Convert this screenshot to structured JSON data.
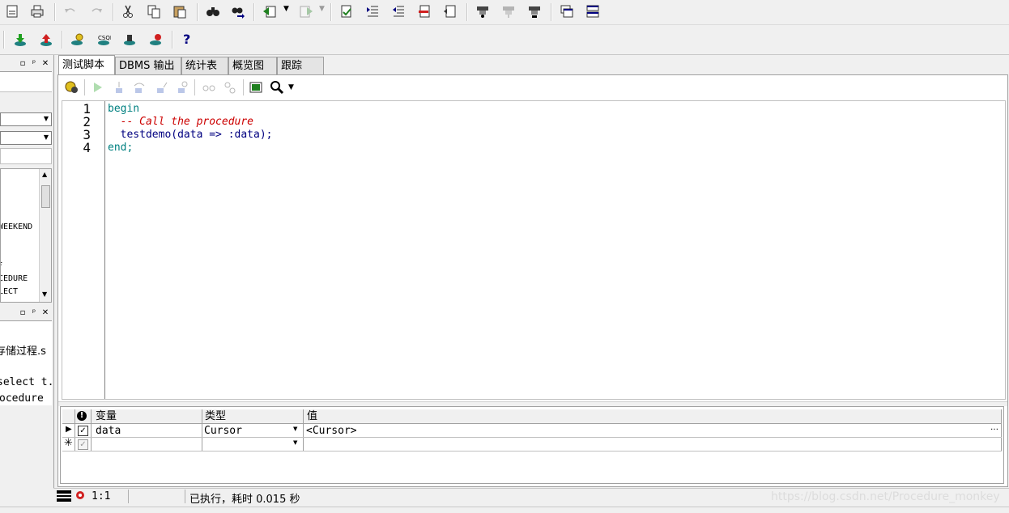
{
  "toolbar_row1": {
    "icons": [
      "new-doc-icon",
      "print-icon",
      "undo-icon",
      "redo-icon",
      "cut-icon",
      "copy-icon",
      "paste-icon",
      "find-icon",
      "replace-icon",
      "back-icon",
      "forward-icon",
      "indent-icon",
      "increase-indent-icon",
      "decrease-indent-icon",
      "comment-icon",
      "uncomment-icon",
      "exec-icon",
      "debug-icon",
      "step-icon",
      "window-list-icon",
      "tile-icon"
    ]
  },
  "toolbar_row2": {
    "help_label": "?"
  },
  "left_panel": {
    "tree_items": [
      "WEEKEND",
      "F",
      "CEDURE",
      "LECT"
    ],
    "files": [
      "存储过程.s",
      "select t.*",
      "ocedure"
    ]
  },
  "tabs": [
    {
      "label": "测试脚本",
      "active": true
    },
    {
      "label": "DBMS 输出",
      "active": false
    },
    {
      "label": "统计表",
      "active": false
    },
    {
      "label": "概览图",
      "active": false
    },
    {
      "label": "跟踪",
      "active": false
    }
  ],
  "editor": {
    "lines": [
      {
        "no": "1",
        "text": "begin",
        "color": "#008080",
        "italic": false
      },
      {
        "no": "2",
        "text": "  -- Call the procedure",
        "color": "#cc0000",
        "italic": true
      },
      {
        "no": "3",
        "text": "  testdemo(data => :data);",
        "color": "#000080",
        "italic": false
      },
      {
        "no": "4",
        "text": "end;",
        "color": "#008080",
        "italic": false
      }
    ]
  },
  "params_grid": {
    "headers": {
      "variable": "变量",
      "type": "类型",
      "value": "值"
    },
    "rows": [
      {
        "variable": "data",
        "type": "Cursor",
        "value": "<Cursor>",
        "checked": true
      }
    ]
  },
  "status": {
    "position": "1:1",
    "message": "已执行，耗时 0.015 秒",
    "watermark": "https://blog.csdn.net/Procedure_monkey"
  }
}
